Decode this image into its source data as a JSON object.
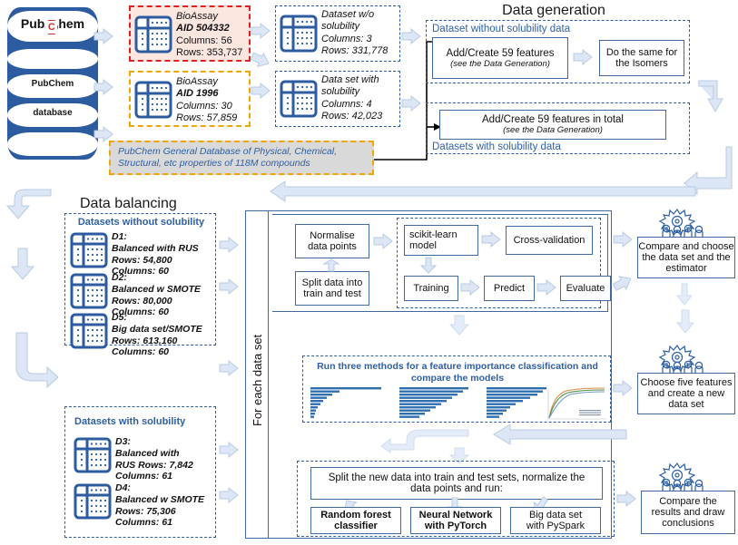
{
  "headings": {
    "data_generation": "Data generation",
    "data_balancing": "Data balancing"
  },
  "source": {
    "logo_top": "Pub",
    "logo_c": "C",
    "logo_rest": "hem",
    "label_line1": "PubChem",
    "label_line2": "database"
  },
  "sources": [
    {
      "id": "bioassay-504332",
      "title": "BioAssay",
      "aid": "AID 504332",
      "columns": "Columns: 56",
      "rows": "Rows: 353,737"
    },
    {
      "id": "bioassay-1996",
      "title": "BioAssay",
      "aid": "AID 1996",
      "columns": "Columns: 30",
      "rows": "Rows: 57,859"
    }
  ],
  "general_db": {
    "line1": "PubChem General Database of Physical, Chemical,",
    "line2": "Structural, etc properties of  118M compounds"
  },
  "datasets_mid": [
    {
      "id": "dataset-wo-solubility",
      "line1": "Dataset w/o",
      "line2": "solubility",
      "columns": "Columns: 3",
      "rows": "Rows: 331,778"
    },
    {
      "id": "dataset-with-solubility",
      "line1": "Data set with",
      "line2": "solubility",
      "columns": "Columns: 4",
      "rows": "Rows: 42,023"
    }
  ],
  "data_generation": {
    "without": {
      "group_label": "Dataset without solubility data",
      "box1_line1": "Add/Create 59 features",
      "box1_line2": "(see the Data Generation)",
      "box2_line1": "Do the same for",
      "box2_line2": "the Isomers"
    },
    "with": {
      "group_label": "Datasets with solubility data",
      "box1_line1": "Add/Create 59 features in total",
      "box1_line2": "(see the Data Generation)"
    }
  },
  "balancing": {
    "group_without_label": "Datasets without solubility",
    "group_with_label": "Datasets with solubility",
    "without": [
      {
        "id": "D1",
        "name": "D1:",
        "method": "Balanced with RUS",
        "rows": "Rows: 54,800",
        "columns": "Columns: 60"
      },
      {
        "id": "D2",
        "name": "D2:",
        "method": "Balanced w SMOTE",
        "rows": "Rows: 80,000",
        "columns": "Columns: 60"
      },
      {
        "id": "D5",
        "name": "D5:",
        "method": "Big data set/SMOTE",
        "rows": "Rows: 613,160",
        "columns": "Columns: 60"
      }
    ],
    "with": [
      {
        "id": "D3",
        "name": "D3:",
        "method": "Balanced with",
        "rows": "RUS Rows: 7,842",
        "columns": "Columns: 61"
      },
      {
        "id": "D4",
        "name": "D4:",
        "method": "Balanced w SMOTE",
        "rows": "Rows: 75,306",
        "columns": "Columns: 61"
      }
    ]
  },
  "pipeline": {
    "vertical_label": "For each data set",
    "normalise_l1": "Normalise",
    "normalise_l2": "data points",
    "split_l1": "Split data into",
    "split_l2": "train and test",
    "sklearn_l1": "scikit-learn",
    "sklearn_l2": "model",
    "crossval": "Cross-validation",
    "training": "Training",
    "predict": "Predict",
    "evaluate": "Evaluate"
  },
  "feature_importance": {
    "title_l1": "Run three methods for a feature importance classification and",
    "title_l2": "compare the models"
  },
  "final_run": {
    "header_l1": "Split the new data into train and test sets, normalize the",
    "header_l2": "data points and run:",
    "options": [
      {
        "id": "rf",
        "line1": "Random forest",
        "line2": "classifier",
        "bold": true
      },
      {
        "id": "nn",
        "line1": "Neural Network",
        "line2": "with PyTorch",
        "bold": true
      },
      {
        "id": "spark",
        "line1": "Big data set",
        "line2": "with PySpark",
        "bold": false
      }
    ]
  },
  "decisions": [
    {
      "id": "compare-choose",
      "line1": "Compare and choose",
      "line2": "the data set and the",
      "line3": "estimator"
    },
    {
      "id": "choose-features",
      "line1": "Choose five features",
      "line2": "and create a new",
      "line3": "data set"
    },
    {
      "id": "compare-results",
      "line1": "Compare the",
      "line2": "results and draw",
      "line3": "conclusions"
    }
  ],
  "colors": {
    "brand_blue": "#2d5ba0",
    "accent_blue": "#2e5fa3",
    "arrow_fill": "#dce6f4",
    "arrow_stroke": "#b6cbe6",
    "red_dash": "#e02020",
    "orange_dash": "#f0a500",
    "grey_fill": "#d9d9d9"
  }
}
